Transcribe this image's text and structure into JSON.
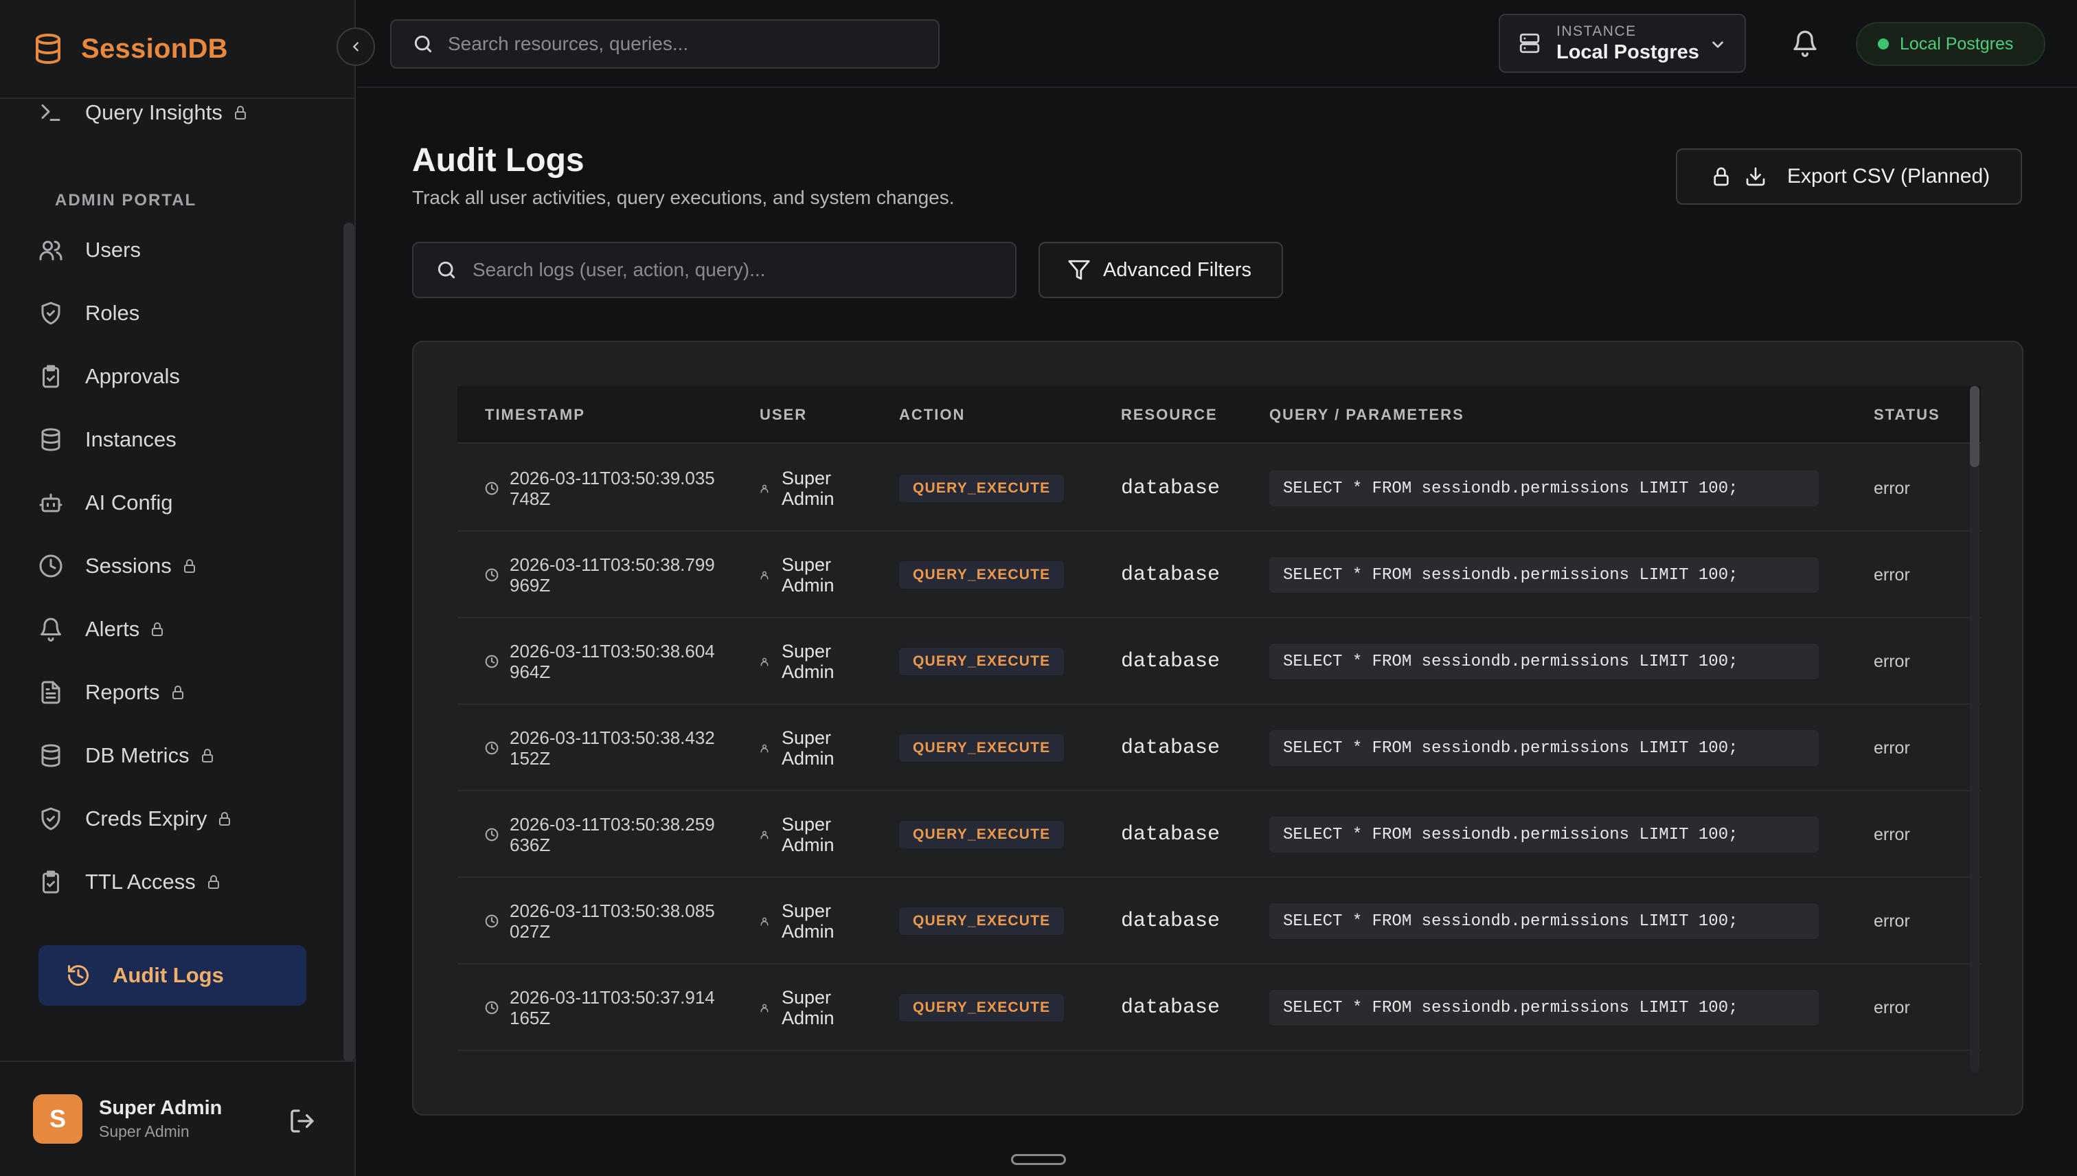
{
  "app": {
    "name": "SessionDB"
  },
  "sidebar": {
    "section_label": "ADMIN PORTAL",
    "top_item": {
      "label": "Query Insights",
      "locked": true,
      "icon": "terminal-icon"
    },
    "items": [
      {
        "label": "Users",
        "locked": false,
        "icon": "users-icon"
      },
      {
        "label": "Roles",
        "locked": false,
        "icon": "shield-check-icon"
      },
      {
        "label": "Approvals",
        "locked": false,
        "icon": "clipboard-check-icon"
      },
      {
        "label": "Instances",
        "locked": false,
        "icon": "database-icon"
      },
      {
        "label": "AI Config",
        "locked": false,
        "icon": "bot-icon"
      },
      {
        "label": "Sessions",
        "locked": true,
        "icon": "clock-icon"
      },
      {
        "label": "Alerts",
        "locked": true,
        "icon": "bell-icon"
      },
      {
        "label": "Reports",
        "locked": true,
        "icon": "file-text-icon"
      },
      {
        "label": "DB Metrics",
        "locked": true,
        "icon": "database-icon"
      },
      {
        "label": "Creds Expiry",
        "locked": true,
        "icon": "shield-check-icon"
      },
      {
        "label": "TTL Access",
        "locked": true,
        "icon": "clipboard-check-icon"
      }
    ],
    "active_item": {
      "label": "Audit Logs",
      "icon": "history-icon"
    },
    "user": {
      "initial": "S",
      "name": "Super Admin",
      "role": "Super Admin"
    }
  },
  "topbar": {
    "search_placeholder": "Search resources, queries...",
    "instance_caption": "INSTANCE",
    "instance_value": "Local Postgres",
    "status_label": "Local Postgres"
  },
  "page": {
    "title": "Audit Logs",
    "subtitle": "Track all user activities, query executions, and system changes.",
    "export_label": "Export CSV (Planned)",
    "log_search_placeholder": "Search logs (user, action, query)...",
    "filters_label": "Advanced Filters"
  },
  "colors": {
    "accent": "#e8893e",
    "active_bg": "#1b2a52",
    "status_green": "#3ec46d",
    "badge_text": "#ef9a4b"
  },
  "table": {
    "columns": {
      "timestamp": "TIMESTAMP",
      "user": "USER",
      "action": "ACTION",
      "resource": "RESOURCE",
      "query": "QUERY / PARAMETERS",
      "status": "STATUS"
    },
    "rows": [
      {
        "timestamp": "2026-03-11T03:50:39.035748Z",
        "user": "Super Admin",
        "action": "QUERY_EXECUTE",
        "resource": "database",
        "query": "SELECT * FROM sessiondb.permissions LIMIT 100;",
        "status": "error"
      },
      {
        "timestamp": "2026-03-11T03:50:38.799969Z",
        "user": "Super Admin",
        "action": "QUERY_EXECUTE",
        "resource": "database",
        "query": "SELECT * FROM sessiondb.permissions LIMIT 100;",
        "status": "error"
      },
      {
        "timestamp": "2026-03-11T03:50:38.604964Z",
        "user": "Super Admin",
        "action": "QUERY_EXECUTE",
        "resource": "database",
        "query": "SELECT * FROM sessiondb.permissions LIMIT 100;",
        "status": "error"
      },
      {
        "timestamp": "2026-03-11T03:50:38.432152Z",
        "user": "Super Admin",
        "action": "QUERY_EXECUTE",
        "resource": "database",
        "query": "SELECT * FROM sessiondb.permissions LIMIT 100;",
        "status": "error"
      },
      {
        "timestamp": "2026-03-11T03:50:38.259636Z",
        "user": "Super Admin",
        "action": "QUERY_EXECUTE",
        "resource": "database",
        "query": "SELECT * FROM sessiondb.permissions LIMIT 100;",
        "status": "error"
      },
      {
        "timestamp": "2026-03-11T03:50:38.085027Z",
        "user": "Super Admin",
        "action": "QUERY_EXECUTE",
        "resource": "database",
        "query": "SELECT * FROM sessiondb.permissions LIMIT 100;",
        "status": "error"
      },
      {
        "timestamp": "2026-03-11T03:50:37.914165Z",
        "user": "Super Admin",
        "action": "QUERY_EXECUTE",
        "resource": "database",
        "query": "SELECT * FROM sessiondb.permissions LIMIT 100;",
        "status": "error"
      }
    ]
  }
}
